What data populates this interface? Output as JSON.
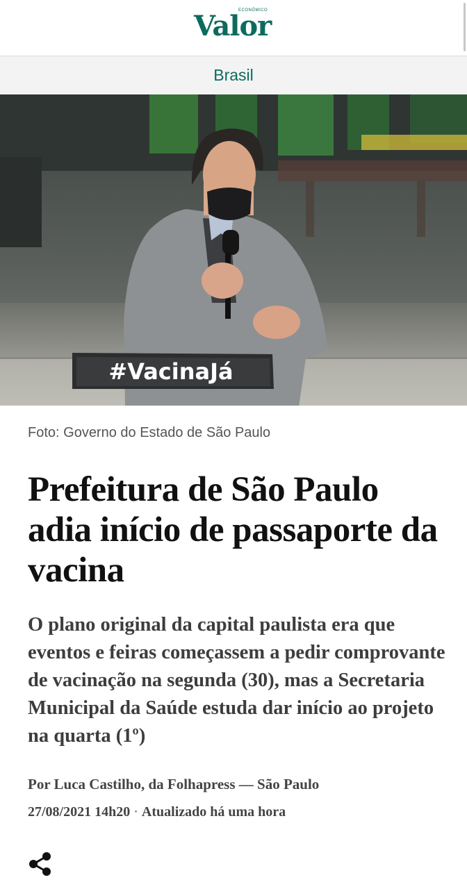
{
  "header": {
    "logo_main": "Valor",
    "logo_small": "ECONÔMICO"
  },
  "section": {
    "label": "Brasil"
  },
  "hero": {
    "sign_text": "#VacinaJá"
  },
  "article": {
    "photo_credit": "Foto: Governo do Estado de São Paulo",
    "headline": "Prefeitura de São Paulo adia início de passaporte da vacina",
    "subtitle": "O plano original da capital paulista era que eventos e feiras começassem a pedir comprovante de vacinação na segunda (30), mas a Secretaria Municipal da Saúde estuda dar início ao projeto na quarta (1º)",
    "byline": "Por Luca Castilho, da Folhapress — São Paulo",
    "published": "27/08/2021 14h20",
    "separator": "·",
    "updated": "Atualizado há uma hora"
  },
  "icons": {
    "share": "share-icon"
  },
  "colors": {
    "brand": "#0c6b5e",
    "text": "#111111",
    "subtitle": "#3d3d3d",
    "section_bg": "#f3f3f3"
  }
}
